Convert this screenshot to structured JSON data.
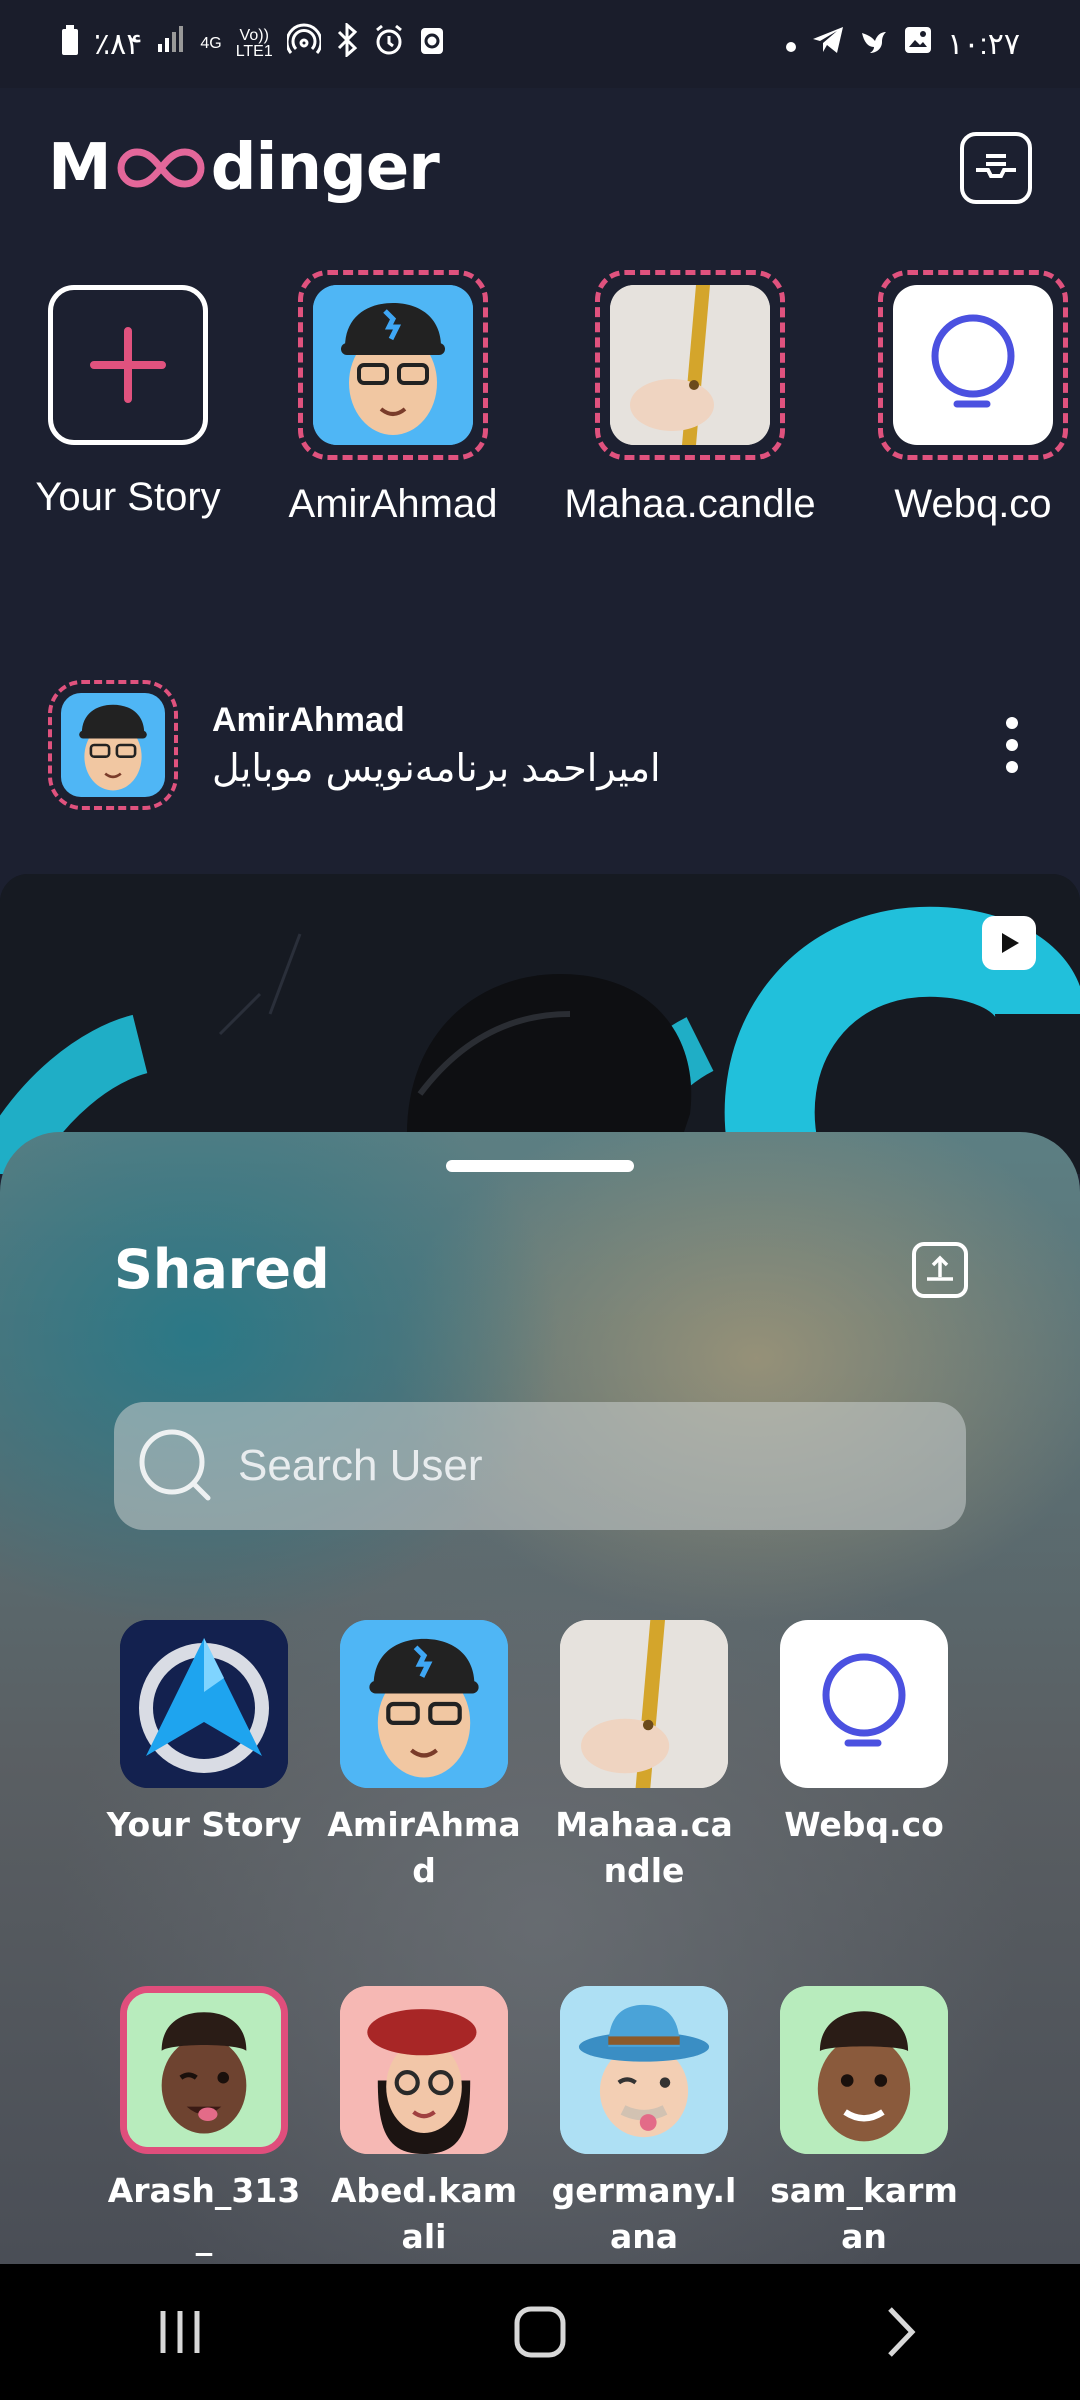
{
  "status_bar": {
    "battery": "٪۸۴",
    "network": "4G",
    "volte_top": "Vo))",
    "volte_bottom": "LTE1",
    "time": "۱۰:۲۷"
  },
  "header": {
    "logo_prefix": "M",
    "logo_suffix": "dinger"
  },
  "stories": [
    {
      "label": "Your Story",
      "type": "add"
    },
    {
      "label": "AmirAhmad",
      "type": "memoji-glasses"
    },
    {
      "label": "Mahaa.candle",
      "type": "candle"
    },
    {
      "label": "Webq.co",
      "type": "webq"
    }
  ],
  "post": {
    "author": "AmirAhmad",
    "description": "امیراحمد برنامه‌نویس موبایل"
  },
  "sheet": {
    "title": "Shared",
    "search_placeholder": "Search User",
    "users": [
      {
        "label": "Your Story",
        "avatar": "app-logo",
        "selected": false
      },
      {
        "label": "AmirAhmad",
        "avatar": "memoji-glasses",
        "selected": false
      },
      {
        "label": "Mahaa.candle",
        "avatar": "candle",
        "selected": false
      },
      {
        "label": "Webq.co",
        "avatar": "webq",
        "selected": false
      },
      {
        "label": "Arash_313_",
        "avatar": "memoji-wink",
        "selected": true
      },
      {
        "label": "Abed.kamali",
        "avatar": "memoji-beret",
        "selected": false
      },
      {
        "label": "germany.lana",
        "avatar": "memoji-hat",
        "selected": false
      },
      {
        "label": "sam_karman",
        "avatar": "memoji-smile",
        "selected": false
      }
    ]
  },
  "colors": {
    "accent": "#e0527e",
    "background": "#1c2030",
    "story_blue": "#4fb6f5"
  }
}
